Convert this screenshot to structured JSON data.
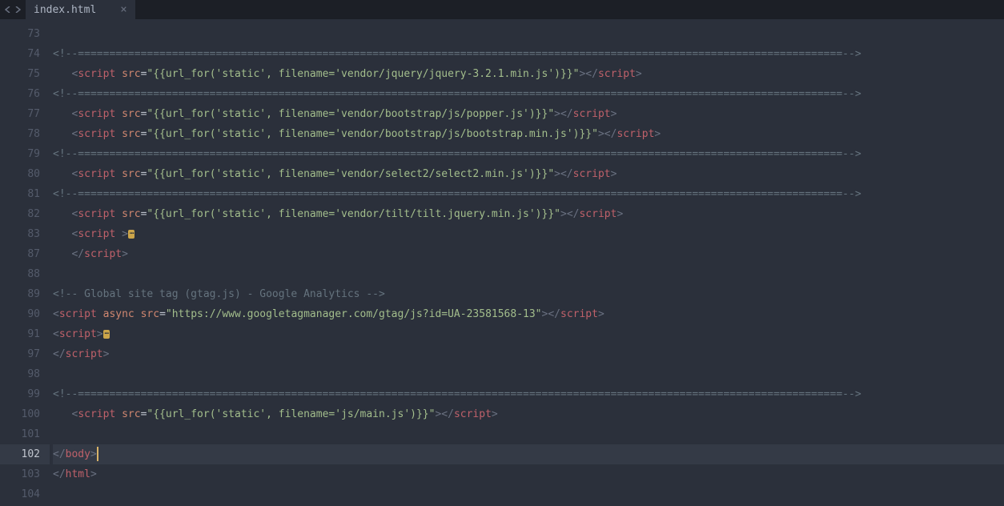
{
  "tab": {
    "filename": "index.html"
  },
  "fold_marker": "⋯",
  "gutter_lines": [
    "73",
    "74",
    "75",
    "76",
    "77",
    "78",
    "79",
    "80",
    "81",
    "82",
    "83",
    "87",
    "88",
    "89",
    "90",
    "91",
    "97",
    "98",
    "99",
    "100",
    "101",
    "102",
    "103",
    "104"
  ],
  "active_line_index": 21,
  "colors": {
    "background": "#2b303b",
    "tag": "#bf616a",
    "attr": "#d08770",
    "string": "#a3be8c",
    "comment": "#65737e",
    "punct": "#6a7181"
  },
  "lines": [
    {
      "indent": 0,
      "tokens": []
    },
    {
      "indent": 0,
      "tokens": [
        {
          "t": "comment",
          "v": "<!--==========================================================================================================================-->"
        }
      ]
    },
    {
      "indent": 1,
      "tokens": [
        {
          "t": "tagopen",
          "v": "script"
        },
        {
          "t": "sp"
        },
        {
          "t": "attr",
          "v": "src"
        },
        {
          "t": "eq"
        },
        {
          "t": "str",
          "v": "\"{{url_for('static', filename='vendor/jquery/jquery-3.2.1.min.js')}}\""
        },
        {
          "t": "tagclose"
        },
        {
          "t": "tagend",
          "v": "script"
        }
      ]
    },
    {
      "indent": 0,
      "tokens": [
        {
          "t": "comment",
          "v": "<!--==========================================================================================================================-->"
        }
      ]
    },
    {
      "indent": 1,
      "tokens": [
        {
          "t": "tagopen",
          "v": "script"
        },
        {
          "t": "sp"
        },
        {
          "t": "attr",
          "v": "src"
        },
        {
          "t": "eq"
        },
        {
          "t": "str",
          "v": "\"{{url_for('static', filename='vendor/bootstrap/js/popper.js')}}\""
        },
        {
          "t": "tagclose"
        },
        {
          "t": "tagend",
          "v": "script"
        }
      ]
    },
    {
      "indent": 1,
      "tokens": [
        {
          "t": "tagopen",
          "v": "script"
        },
        {
          "t": "sp"
        },
        {
          "t": "attr",
          "v": "src"
        },
        {
          "t": "eq"
        },
        {
          "t": "str",
          "v": "\"{{url_for('static', filename='vendor/bootstrap/js/bootstrap.min.js')}}\""
        },
        {
          "t": "tagclose"
        },
        {
          "t": "tagend",
          "v": "script"
        }
      ]
    },
    {
      "indent": 0,
      "tokens": [
        {
          "t": "comment",
          "v": "<!--==========================================================================================================================-->"
        }
      ]
    },
    {
      "indent": 1,
      "tokens": [
        {
          "t": "tagopen",
          "v": "script"
        },
        {
          "t": "sp"
        },
        {
          "t": "attr",
          "v": "src"
        },
        {
          "t": "eq"
        },
        {
          "t": "str",
          "v": "\"{{url_for('static', filename='vendor/select2/select2.min.js')}}\""
        },
        {
          "t": "tagclose"
        },
        {
          "t": "tagend",
          "v": "script"
        }
      ]
    },
    {
      "indent": 0,
      "tokens": [
        {
          "t": "comment",
          "v": "<!--==========================================================================================================================-->"
        }
      ]
    },
    {
      "indent": 1,
      "tokens": [
        {
          "t": "tagopen",
          "v": "script"
        },
        {
          "t": "sp"
        },
        {
          "t": "attr",
          "v": "src"
        },
        {
          "t": "eq"
        },
        {
          "t": "str",
          "v": "\"{{url_for('static', filename='vendor/tilt/tilt.jquery.min.js')}}\""
        },
        {
          "t": "tagclose"
        },
        {
          "t": "tagend",
          "v": "script"
        }
      ]
    },
    {
      "indent": 1,
      "tokens": [
        {
          "t": "tagopen",
          "v": "script"
        },
        {
          "t": "sp"
        },
        {
          "t": "tagclose"
        },
        {
          "t": "fold"
        }
      ]
    },
    {
      "indent": 1,
      "tokens": [
        {
          "t": "tagend",
          "v": "script"
        }
      ]
    },
    {
      "indent": 0,
      "tokens": []
    },
    {
      "indent": 0,
      "tokens": [
        {
          "t": "comment",
          "v": "<!-- Global site tag (gtag.js) - Google Analytics -->"
        }
      ]
    },
    {
      "indent": 0,
      "tokens": [
        {
          "t": "tagopen",
          "v": "script"
        },
        {
          "t": "sp"
        },
        {
          "t": "attr",
          "v": "async"
        },
        {
          "t": "sp"
        },
        {
          "t": "attr",
          "v": "src"
        },
        {
          "t": "eq"
        },
        {
          "t": "str",
          "v": "\"https://www.googletagmanager.com/gtag/js?id=UA-23581568-13\""
        },
        {
          "t": "tagclose"
        },
        {
          "t": "tagend",
          "v": "script"
        }
      ]
    },
    {
      "indent": 0,
      "tokens": [
        {
          "t": "tagopen",
          "v": "script"
        },
        {
          "t": "tagclose"
        },
        {
          "t": "fold"
        }
      ]
    },
    {
      "indent": 0,
      "tokens": [
        {
          "t": "tagend",
          "v": "script"
        }
      ]
    },
    {
      "indent": 0,
      "tokens": []
    },
    {
      "indent": 0,
      "tokens": [
        {
          "t": "comment",
          "v": "<!--==========================================================================================================================-->"
        }
      ]
    },
    {
      "indent": 1,
      "tokens": [
        {
          "t": "tagopen",
          "v": "script"
        },
        {
          "t": "sp"
        },
        {
          "t": "attr",
          "v": "src"
        },
        {
          "t": "eq"
        },
        {
          "t": "str",
          "v": "\"{{url_for('static', filename='js/main.js')}}\""
        },
        {
          "t": "tagclose"
        },
        {
          "t": "tagend",
          "v": "script"
        }
      ]
    },
    {
      "indent": 0,
      "tokens": []
    },
    {
      "indent": 0,
      "tokens": [
        {
          "t": "tagend",
          "v": "body"
        },
        {
          "t": "cursor"
        }
      ]
    },
    {
      "indent": 0,
      "tokens": [
        {
          "t": "tagend",
          "v": "html"
        }
      ]
    },
    {
      "indent": 0,
      "tokens": []
    }
  ]
}
